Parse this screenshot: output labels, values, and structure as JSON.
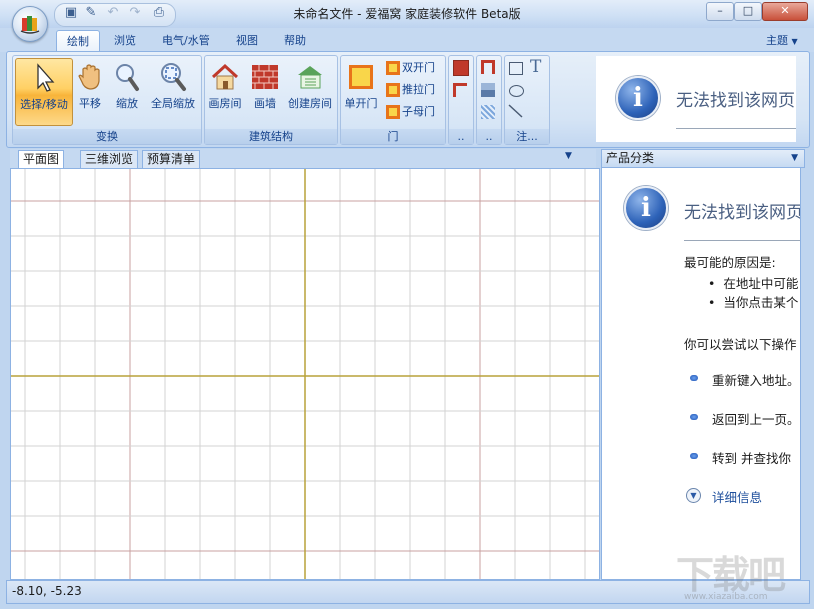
{
  "window": {
    "title": "未命名文件 - 爱福窝 家庭装修软件 Beta版",
    "minimize": "–",
    "maximize": "□",
    "close": "✕"
  },
  "qat": [
    "save-icon",
    "new-icon",
    "undo-icon",
    "redo-icon",
    "print-icon"
  ],
  "ribbon": {
    "tabs": [
      "绘制",
      "浏览",
      "电气/水管",
      "视图",
      "帮助"
    ],
    "active_tab": "绘制",
    "theme_label": "主题",
    "groups": {
      "transform": {
        "label": "变换",
        "buttons": [
          "选择/移动",
          "平移",
          "缩放",
          "全局缩放"
        ]
      },
      "structure": {
        "label": "建筑结构",
        "buttons": [
          "画房间",
          "画墙",
          "创建房间"
        ]
      },
      "door": {
        "label": "门",
        "big_button": "单开门",
        "small_buttons": [
          "双开门",
          "推拉门",
          "子母门"
        ]
      },
      "group4": {
        "label": ".."
      },
      "group5": {
        "label": ".."
      },
      "annotation": {
        "label": "注..."
      }
    },
    "preview_text": "无法找到该网页"
  },
  "document_tabs": [
    "平面图",
    "三维浏览",
    "预算清单"
  ],
  "side_panel": {
    "header": "产品分类",
    "error_title": "无法找到该网页",
    "reasons_heading": "最可能的原因是:",
    "reasons": [
      "在地址中可能",
      "当你点击某个"
    ],
    "try_heading": "你可以尝试以下操作",
    "actions": [
      "重新键入地址。",
      "返回到上一页。",
      "转到  并查找你"
    ],
    "details": "详细信息"
  },
  "statusbar": {
    "coords": "-8.10, -5.23"
  },
  "watermark": "下载吧",
  "watermark_sub": "www.xiazaiba.com",
  "colors": {
    "grid_minor": "#d3d3d3",
    "grid_major": "#c9a0a0",
    "grid_axis": "#b8a23a",
    "accent": "#15428b"
  }
}
